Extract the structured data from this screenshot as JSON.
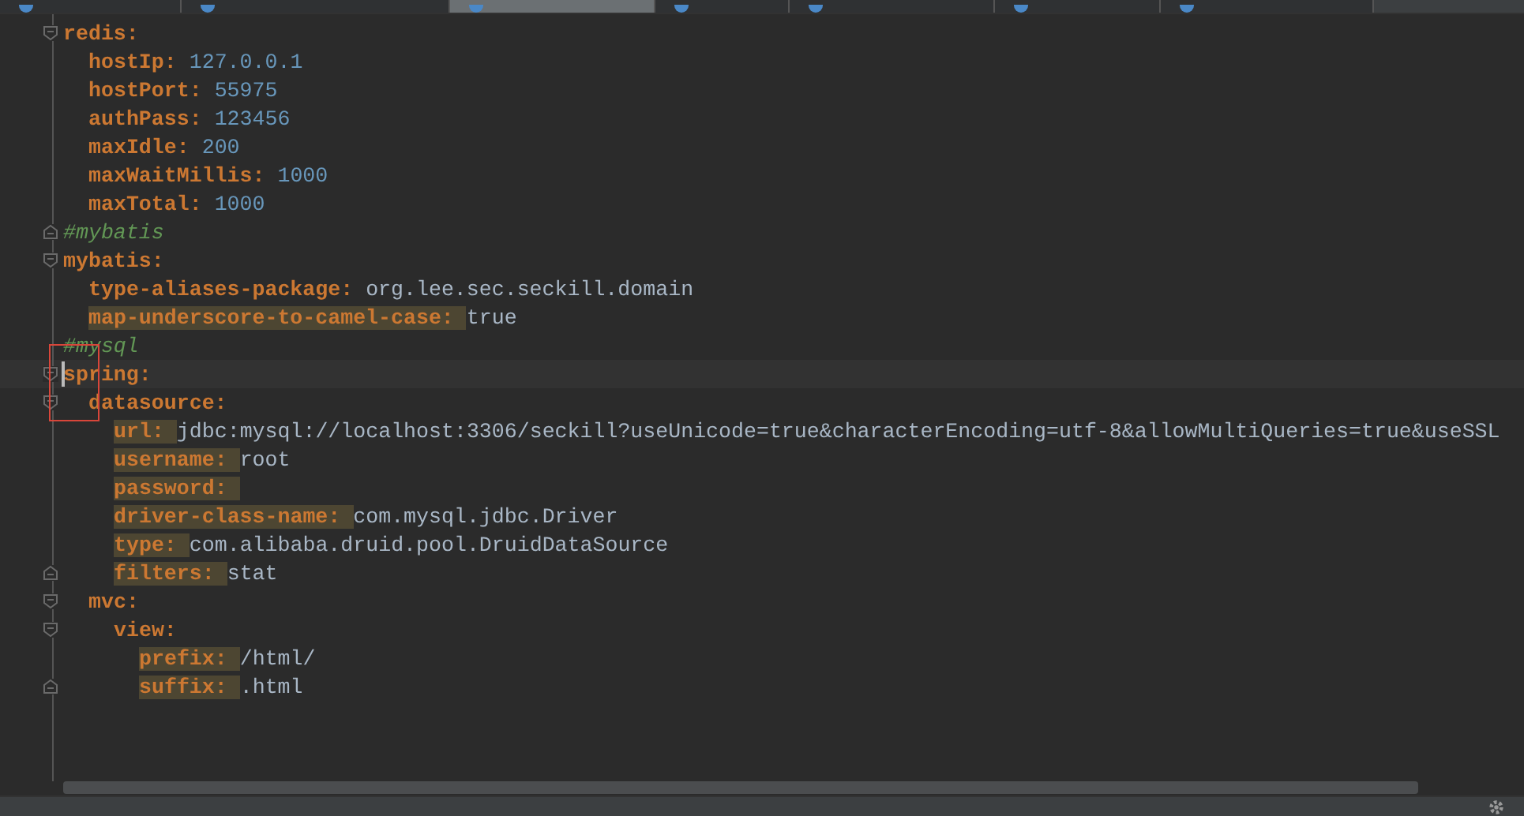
{
  "tabs": [
    {
      "selected": false
    },
    {
      "selected": false
    },
    {
      "selected": true
    },
    {
      "selected": false
    },
    {
      "selected": false
    },
    {
      "selected": false
    },
    {
      "selected": false
    }
  ],
  "editor": {
    "lines": [
      {
        "kind": "entry",
        "key": "redis:",
        "highlighted": false,
        "fold_start": true,
        "fold_end": false,
        "current": false,
        "children": [
          {
            "kind": "entry",
            "key": "hostIp:",
            "value": "127.0.0.1",
            "numeric": true,
            "highlighted": false,
            "fold_start": false,
            "fold_end": false,
            "current": false
          },
          {
            "kind": "entry",
            "key": "hostPort:",
            "value": "55975",
            "numeric": true,
            "highlighted": false,
            "fold_start": false,
            "fold_end": false,
            "current": false
          },
          {
            "kind": "entry",
            "key": "authPass:",
            "value": "123456",
            "numeric": true,
            "highlighted": false,
            "fold_start": false,
            "fold_end": false,
            "current": false
          },
          {
            "kind": "entry",
            "key": "maxIdle:",
            "value": "200",
            "numeric": true,
            "highlighted": false,
            "fold_start": false,
            "fold_end": false,
            "current": false
          },
          {
            "kind": "entry",
            "key": "maxWaitMillis:",
            "value": "1000",
            "numeric": true,
            "highlighted": false,
            "fold_start": false,
            "fold_end": false,
            "current": false
          },
          {
            "kind": "entry",
            "key": "maxTotal:",
            "value": "1000",
            "numeric": true,
            "highlighted": false,
            "fold_start": false,
            "fold_end": false,
            "current": false
          }
        ]
      },
      {
        "kind": "comment",
        "text": "#mybatis",
        "fold_start": false,
        "fold_end": true,
        "current": false
      },
      {
        "kind": "entry",
        "key": "mybatis:",
        "highlighted": false,
        "fold_start": true,
        "fold_end": false,
        "current": false,
        "children": [
          {
            "kind": "entry",
            "key": "type-aliases-package:",
            "value": "org.lee.sec.seckill.domain",
            "numeric": false,
            "highlighted": false,
            "fold_start": false,
            "fold_end": false,
            "current": false
          },
          {
            "kind": "entry",
            "key": "map-underscore-to-camel-case:",
            "value": "true",
            "numeric": false,
            "highlighted": true,
            "fold_start": false,
            "fold_end": false,
            "current": false
          }
        ]
      },
      {
        "kind": "comment",
        "text": "#mysql",
        "fold_start": false,
        "fold_end": false,
        "current": false
      },
      {
        "kind": "entry",
        "key": "spring:",
        "highlighted": false,
        "fold_start": true,
        "fold_end": false,
        "current": true,
        "children": [
          {
            "kind": "entry",
            "key": "datasource:",
            "highlighted": false,
            "fold_start": true,
            "fold_end": false,
            "current": false,
            "children": [
              {
                "kind": "entry",
                "key": "url:",
                "value": "jdbc:mysql://localhost:3306/seckill?useUnicode=true&characterEncoding=utf-8&allowMultiQueries=true&useSSL",
                "numeric": false,
                "highlighted": true,
                "fold_start": false,
                "fold_end": false,
                "current": false
              },
              {
                "kind": "entry",
                "key": "username:",
                "value": "root",
                "numeric": false,
                "highlighted": true,
                "fold_start": false,
                "fold_end": false,
                "current": false
              },
              {
                "kind": "entry",
                "key": "password:",
                "highlighted": true,
                "fold_start": false,
                "fold_end": false,
                "current": false
              },
              {
                "kind": "entry",
                "key": "driver-class-name:",
                "value": "com.mysql.jdbc.Driver",
                "numeric": false,
                "highlighted": true,
                "fold_start": false,
                "fold_end": false,
                "current": false
              },
              {
                "kind": "entry",
                "key": "type:",
                "value": "com.alibaba.druid.pool.DruidDataSource",
                "numeric": false,
                "highlighted": true,
                "fold_start": false,
                "fold_end": false,
                "current": false
              },
              {
                "kind": "entry",
                "key": "filters:",
                "value": "stat",
                "numeric": false,
                "highlighted": true,
                "fold_start": false,
                "fold_end": true,
                "current": false
              }
            ]
          },
          {
            "kind": "entry",
            "key": "mvc:",
            "highlighted": false,
            "fold_start": true,
            "fold_end": false,
            "current": false,
            "children": [
              {
                "kind": "entry",
                "key": "view:",
                "highlighted": false,
                "fold_start": true,
                "fold_end": false,
                "current": false,
                "children": [
                  {
                    "kind": "entry",
                    "key": "prefix:",
                    "value": "/html/",
                    "numeric": false,
                    "highlighted": true,
                    "fold_start": false,
                    "fold_end": false,
                    "current": false
                  },
                  {
                    "kind": "entry",
                    "key": "suffix:",
                    "value": ".html",
                    "numeric": false,
                    "highlighted": true,
                    "fold_start": false,
                    "fold_end": true,
                    "current": false
                  }
                ]
              }
            ]
          }
        ]
      }
    ]
  }
}
